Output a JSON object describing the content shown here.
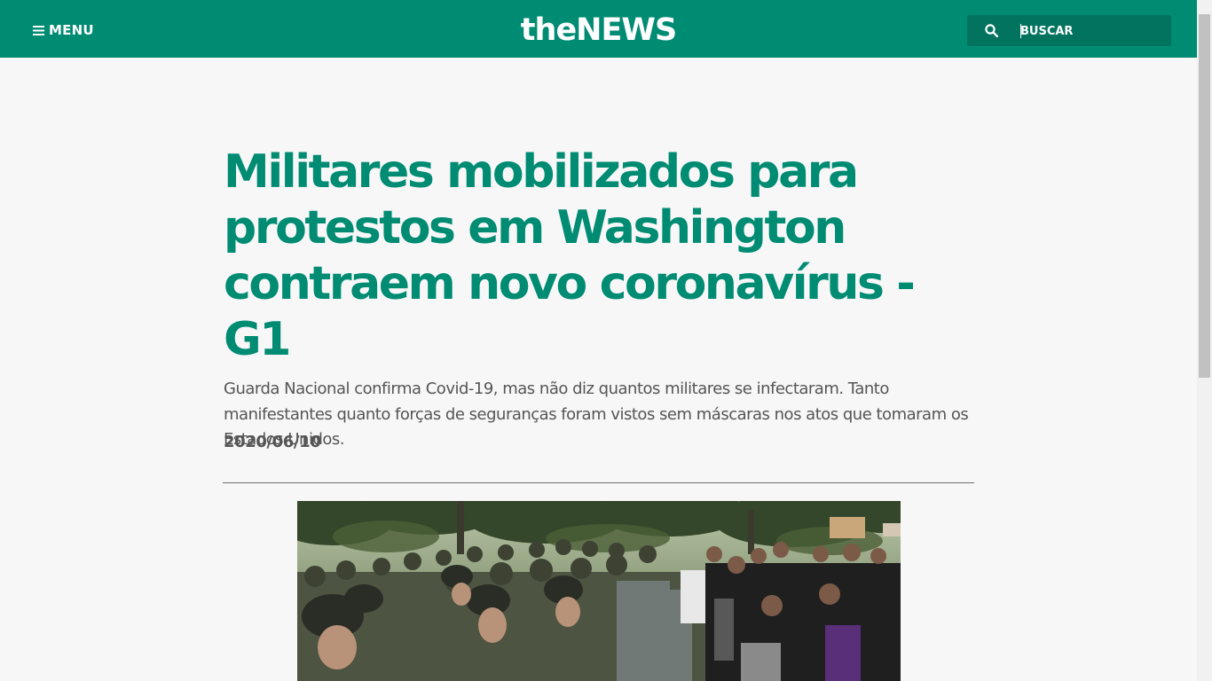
{
  "header": {
    "menu_label": "MENU",
    "menu_icon": "hamburger-icon",
    "logo_text": "theNEWS",
    "search": {
      "placeholder": "BUSCAR",
      "value": "",
      "icon": "search-icon"
    }
  },
  "article": {
    "headline": "Militares mobilizados para protestos em Washington contraem novo coronavírus - G1",
    "dek": "Guarda Nacional confirma Covid-19, mas não diz quantos militares se infectaram. Tanto manifestantes quanto forças de seguranças foram vistos sem máscaras nos atos que tomaram os Estados Unidos.",
    "date": "2020/06/10",
    "image_subject": "National Guard soldiers in helmets facing protesters on a street"
  },
  "colors": {
    "brand": "#008b73",
    "search_bg": "#02735f",
    "page_bg": "#f7f7f8",
    "text": "#555555"
  }
}
